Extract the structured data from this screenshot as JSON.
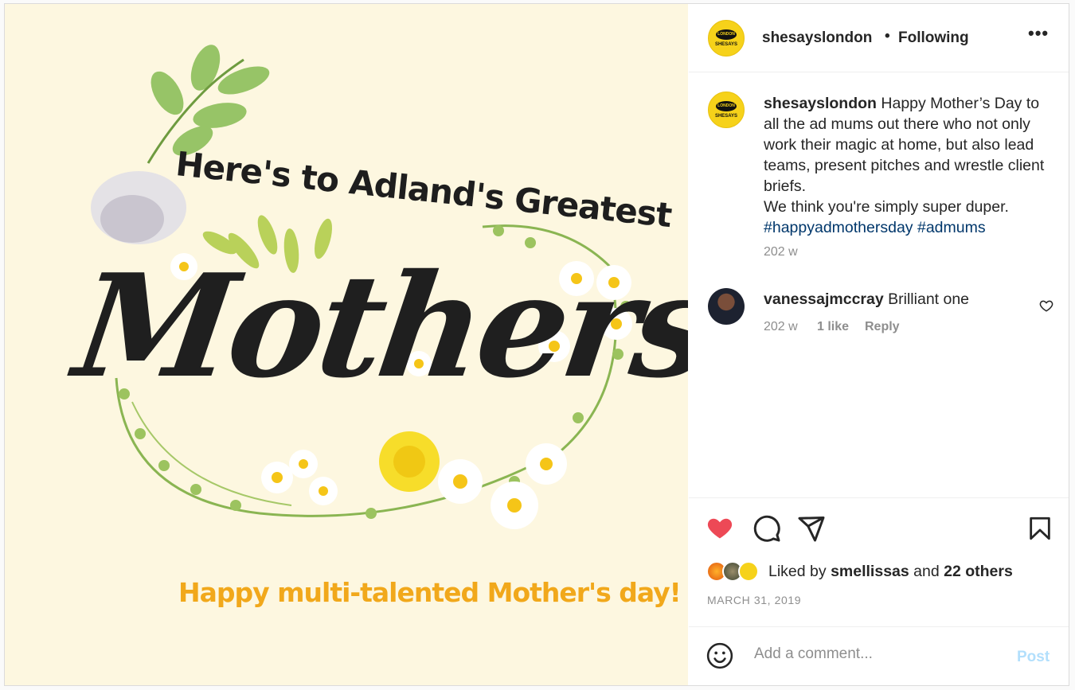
{
  "image": {
    "top_line": "Here's to Adland's Greatest",
    "main_word": "Mothers",
    "bottom_line": "Happy multi-talented Mother's day!",
    "colors": {
      "background": "#fdf7e0",
      "leaf": "#7fae4a",
      "flower_center": "#f5c518"
    }
  },
  "header": {
    "avatar": "shesays-logo-avatar",
    "logo_top": "LONDON",
    "logo_bottom": "SHESAYS",
    "username": "shesayslondon",
    "separator": "•",
    "following": "Following",
    "more": "•••"
  },
  "caption": {
    "username": "shesayslondon",
    "text": "Happy Mother’s Day to all the ad mums out there who not only work their magic at home, but also lead teams, present pitches and wrestle client briefs.",
    "text2": "We think you're simply super duper.",
    "hashtag1": "#happyadmothersday",
    "hashtag2": "#admums",
    "age": "202 w"
  },
  "comment": {
    "username": "vanessajmccray",
    "text": "Brilliant one",
    "age": "202 w",
    "likes": "1 like",
    "reply": "Reply"
  },
  "likes": {
    "prefix": "Liked by",
    "user": "smellissas",
    "and": "and",
    "others": "22 others"
  },
  "date": "MARCH 31, 2019",
  "add_comment": {
    "placeholder": "Add a comment...",
    "post": "Post"
  },
  "colors": {
    "like_red": "#ed4956",
    "hashtag": "#00376b",
    "post_disabled": "#b2dffc",
    "logo_yellow": "#f6d21a"
  }
}
